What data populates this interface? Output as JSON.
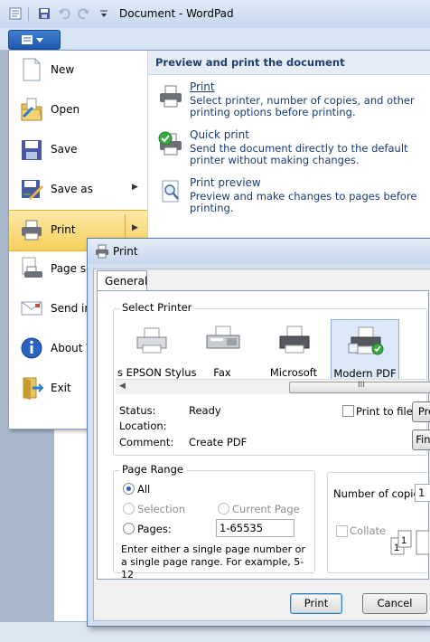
{
  "window": {
    "title": "Document - WordPad"
  },
  "menu": {
    "items": [
      {
        "label": "New",
        "icon": "new-document-icon"
      },
      {
        "label": "Open",
        "icon": "open-folder-icon"
      },
      {
        "label": "Save",
        "icon": "save-disk-icon"
      },
      {
        "label": "Save as",
        "icon": "save-as-icon"
      },
      {
        "label": "Print",
        "icon": "printer-icon"
      },
      {
        "label": "Page se",
        "icon": "page-setup-icon"
      },
      {
        "label": "Send in",
        "icon": "email-icon"
      },
      {
        "label": "About V",
        "icon": "info-icon"
      },
      {
        "label": "Exit",
        "icon": "exit-icon"
      }
    ],
    "pane_title": "Preview and print the document",
    "print_options": [
      {
        "title": "Print",
        "desc": "Select printer, number of copies, and other printing options before printing."
      },
      {
        "title": "Quick print",
        "desc": "Send the document directly to the default printer without making changes."
      },
      {
        "title": "Print preview",
        "desc": "Preview and make changes to pages before printing."
      }
    ]
  },
  "dialog": {
    "title": "Print",
    "tab": "General",
    "select_printer_label": "Select Printer",
    "printers": [
      {
        "label": "s EPSON Stylus"
      },
      {
        "label": "Fax"
      },
      {
        "label": "Microsoft"
      },
      {
        "label": "Modern PDF"
      }
    ],
    "scroll_mark": "III",
    "status_label": "Status:",
    "status_value": "Ready",
    "location_label": "Location:",
    "comment_label": "Comment:",
    "comment_value": "Create PDF",
    "print_to_file": "Print to file",
    "prefs_btn": "Pre",
    "find_btn": "Fing",
    "page_range_label": "Page Range",
    "all_label": "All",
    "selection_label": "Selection",
    "current_page_label": "Current Page",
    "pages_label": "Pages:",
    "pages_value": "1-65535",
    "range_hint": "Enter either a single page number or a single page range.  For example, 5-12",
    "copies_label": "Number of copies:",
    "copies_value": "1",
    "collate_label": "Collate",
    "print_btn": "Print",
    "cancel_btn": "Cancel"
  }
}
